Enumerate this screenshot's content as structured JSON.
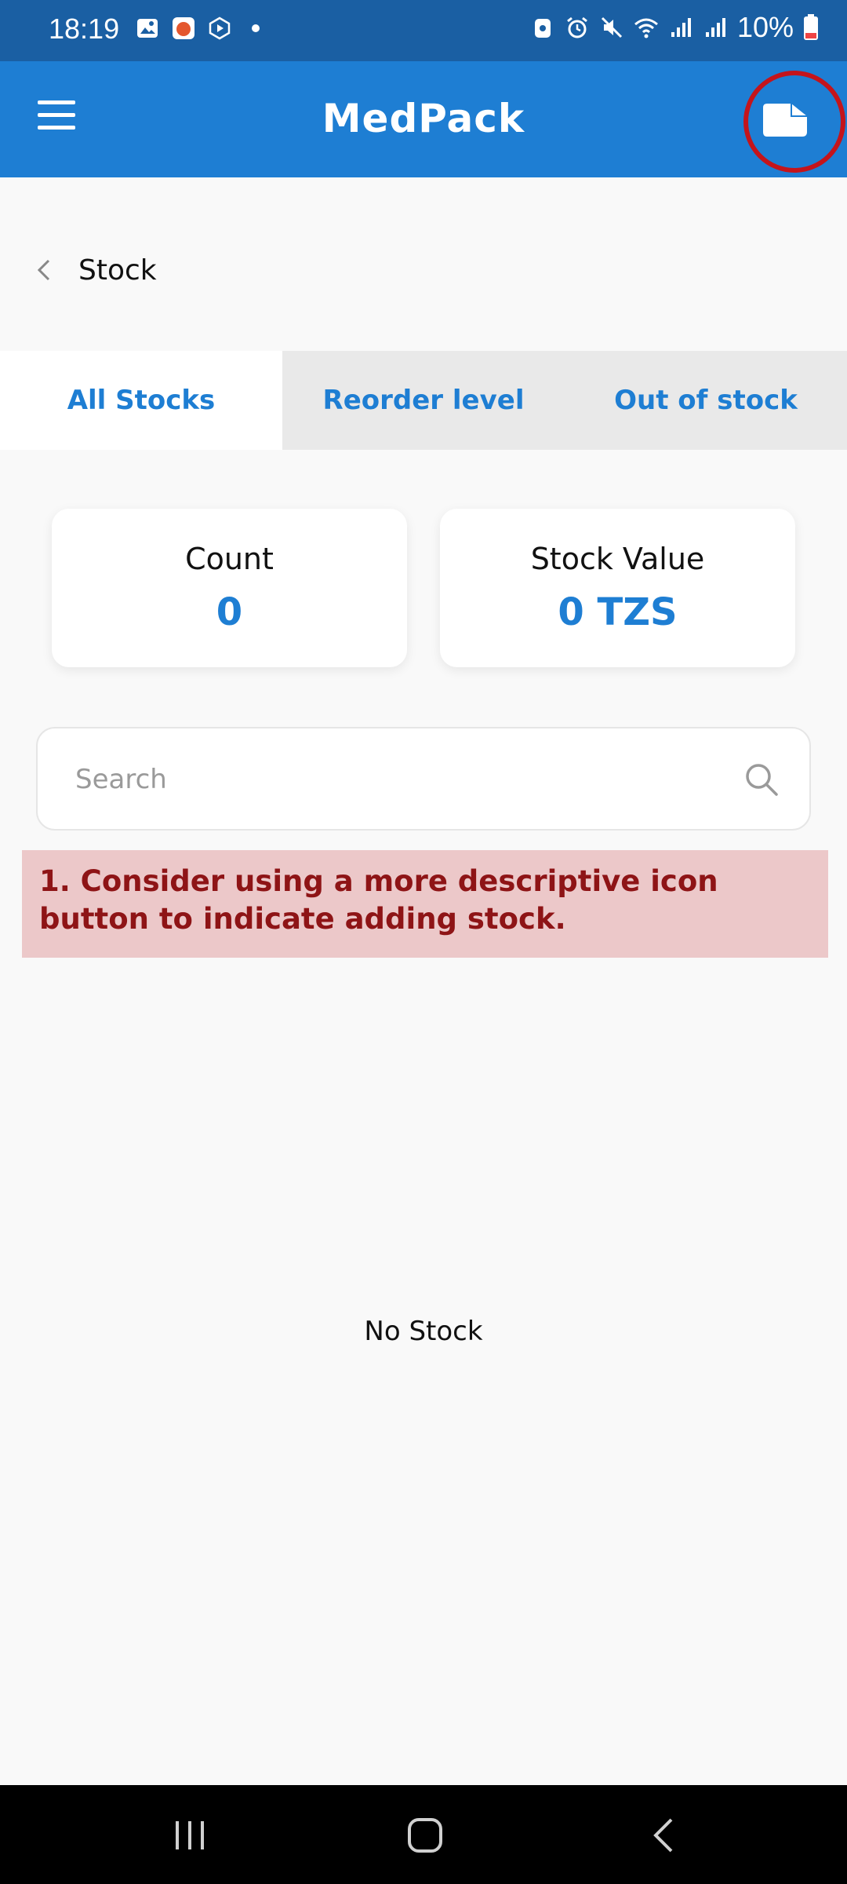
{
  "status_bar": {
    "time": "18:19",
    "battery": "10%",
    "left_icons": [
      "gallery-icon",
      "app-icon",
      "media-icon",
      "dot-icon"
    ],
    "right_icons": [
      "vpn-icon",
      "alarm-icon",
      "mute-icon",
      "wifi-icon",
      "signal-icon",
      "signal-icon",
      "battery-icon"
    ]
  },
  "app_bar": {
    "title": "MedPack",
    "menu_icon": "hamburger-icon",
    "action_icon": "add-stock-icon"
  },
  "breadcrumb": {
    "label": "Stock"
  },
  "tabs": [
    {
      "label": "All Stocks",
      "active": true
    },
    {
      "label": "Reorder level",
      "active": false
    },
    {
      "label": "Out of stock",
      "active": false
    }
  ],
  "summary": {
    "count": {
      "title": "Count",
      "value": "0"
    },
    "stock_value": {
      "title": "Stock Value",
      "value": "0 TZS"
    }
  },
  "search": {
    "placeholder": "Search",
    "value": ""
  },
  "annotation": {
    "text": "1. Consider using a more descriptive icon button to indicate adding stock."
  },
  "empty_state": {
    "text": "No Stock"
  },
  "colors": {
    "primary": "#1e7ed3",
    "status_bar": "#1a5fa3",
    "highlight": "#c4141b",
    "annotation_bg": "#ecc8c9",
    "annotation_text": "#8e1416"
  }
}
